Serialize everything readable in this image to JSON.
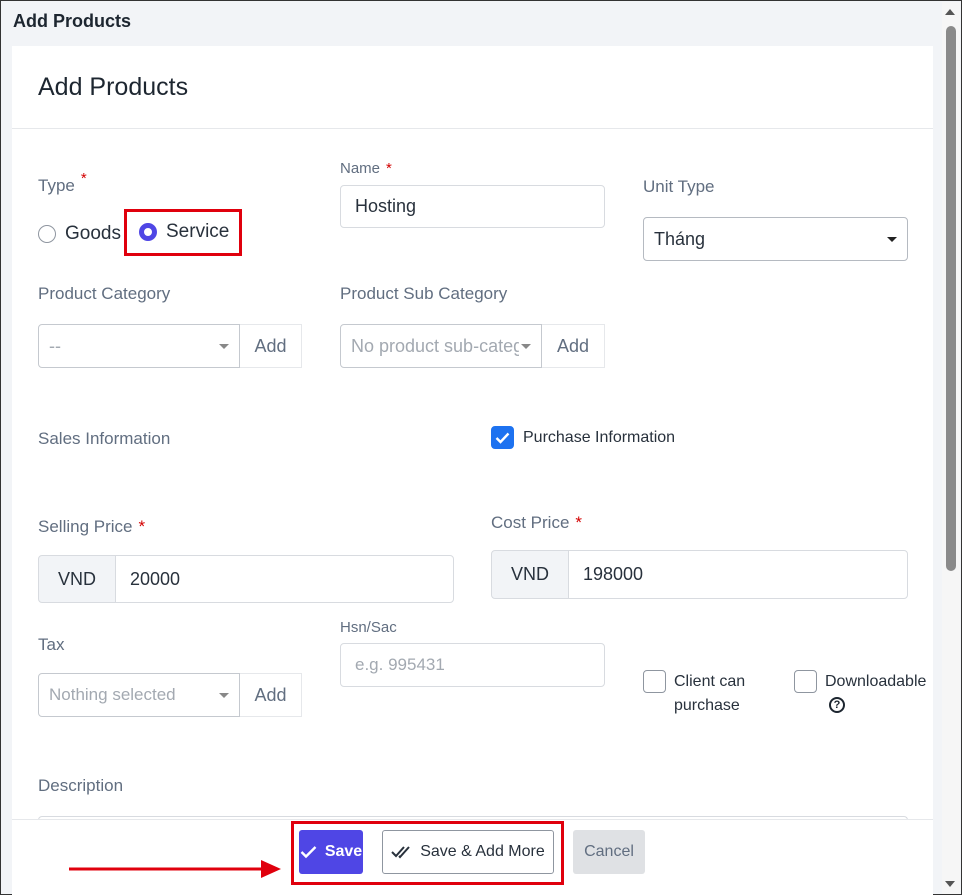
{
  "window": {
    "title": "Add Products"
  },
  "modal": {
    "title": "Add Products"
  },
  "type_field": {
    "label": "Type",
    "required_mark": "*",
    "options": [
      {
        "label": "Goods",
        "selected": false
      },
      {
        "label": "Service",
        "selected": true
      }
    ]
  },
  "name_field": {
    "label": "Name",
    "required_mark": "*",
    "value": "Hosting"
  },
  "unit_type": {
    "label": "Unit Type",
    "value": "Tháng"
  },
  "product_category": {
    "label": "Product Category",
    "value": "--",
    "add_label": "Add"
  },
  "product_sub_category": {
    "label": "Product Sub Category",
    "value": "No product sub-categ",
    "add_label": "Add"
  },
  "sales_information": {
    "label": "Sales Information"
  },
  "purchase_information": {
    "label": "Purchase Information",
    "checked": true
  },
  "selling_price": {
    "label": "Selling Price",
    "required_mark": "*",
    "currency": "VND",
    "value": "20000"
  },
  "cost_price": {
    "label": "Cost Price",
    "required_mark": "*",
    "currency": "VND",
    "value": "198000"
  },
  "tax": {
    "label": "Tax",
    "value": "Nothing selected",
    "add_label": "Add"
  },
  "hsn_sac": {
    "label": "Hsn/Sac",
    "placeholder": "e.g. 995431"
  },
  "client_can_purchase": {
    "label_line1": "Client can",
    "label_line2": "purchase",
    "checked": false
  },
  "downloadable": {
    "label": "Downloadable",
    "help_icon": "?",
    "checked": false
  },
  "description": {
    "label": "Description"
  },
  "footer": {
    "save_label": "Save",
    "save_add_more_label": "Save & Add More",
    "cancel_label": "Cancel"
  },
  "colors": {
    "accent": "#4f46e5",
    "checkbox_blue": "#1d72f0",
    "required": "#d30000",
    "highlight_red": "#e0000d"
  }
}
